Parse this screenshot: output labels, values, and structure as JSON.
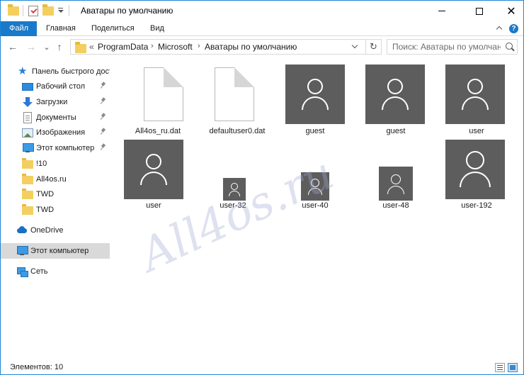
{
  "window": {
    "title": "Аватары по умолчанию",
    "controls": {
      "minimize": "–",
      "maximize": "□",
      "close": "✕"
    }
  },
  "ribbon": {
    "tabs": [
      "Файл",
      "Главная",
      "Поделиться",
      "Вид"
    ],
    "help": "?"
  },
  "nav": {
    "back": "←",
    "forward": "→",
    "recent": "⌄",
    "up": "↑",
    "path_lead": "«",
    "path": [
      "ProgramData",
      "Microsoft",
      "Аватары по умолчанию"
    ],
    "separator": "›",
    "refresh": "↻",
    "search_placeholder": "Поиск: Аватары по умолчан..."
  },
  "sidebar": {
    "quick_access": "Панель быстрого доступа",
    "pinned": [
      {
        "label": "Рабочий стол",
        "icon": "desktop-icon"
      },
      {
        "label": "Загрузки",
        "icon": "downloads-icon"
      },
      {
        "label": "Документы",
        "icon": "documents-icon"
      },
      {
        "label": "Изображения",
        "icon": "pictures-icon"
      },
      {
        "label": "Этот компьютер",
        "icon": "computer-icon"
      }
    ],
    "folders": [
      "!10",
      "All4os.ru",
      "TWD",
      "TWD"
    ],
    "onedrive": "OneDrive",
    "this_pc": "Этот компьютер",
    "network": "Сеть"
  },
  "files": [
    {
      "name": "All4os_ru.dat",
      "type": "file"
    },
    {
      "name": "defaultuser0.dat",
      "type": "file"
    },
    {
      "name": "guest",
      "type": "avatar"
    },
    {
      "name": "guest",
      "type": "avatar"
    },
    {
      "name": "user",
      "type": "avatar"
    },
    {
      "name": "user",
      "type": "avatar"
    },
    {
      "name": "user-32",
      "type": "avatar"
    },
    {
      "name": "user-40",
      "type": "avatar"
    },
    {
      "name": "user-48",
      "type": "avatar"
    },
    {
      "name": "user-192",
      "type": "avatar"
    }
  ],
  "status": {
    "items_count": "Элементов: 10"
  },
  "watermark": "All4os.ru",
  "colors": {
    "accent": "#1979ca",
    "avatar_bg": "#5d5d5d",
    "selected": "#d9d9d9"
  }
}
